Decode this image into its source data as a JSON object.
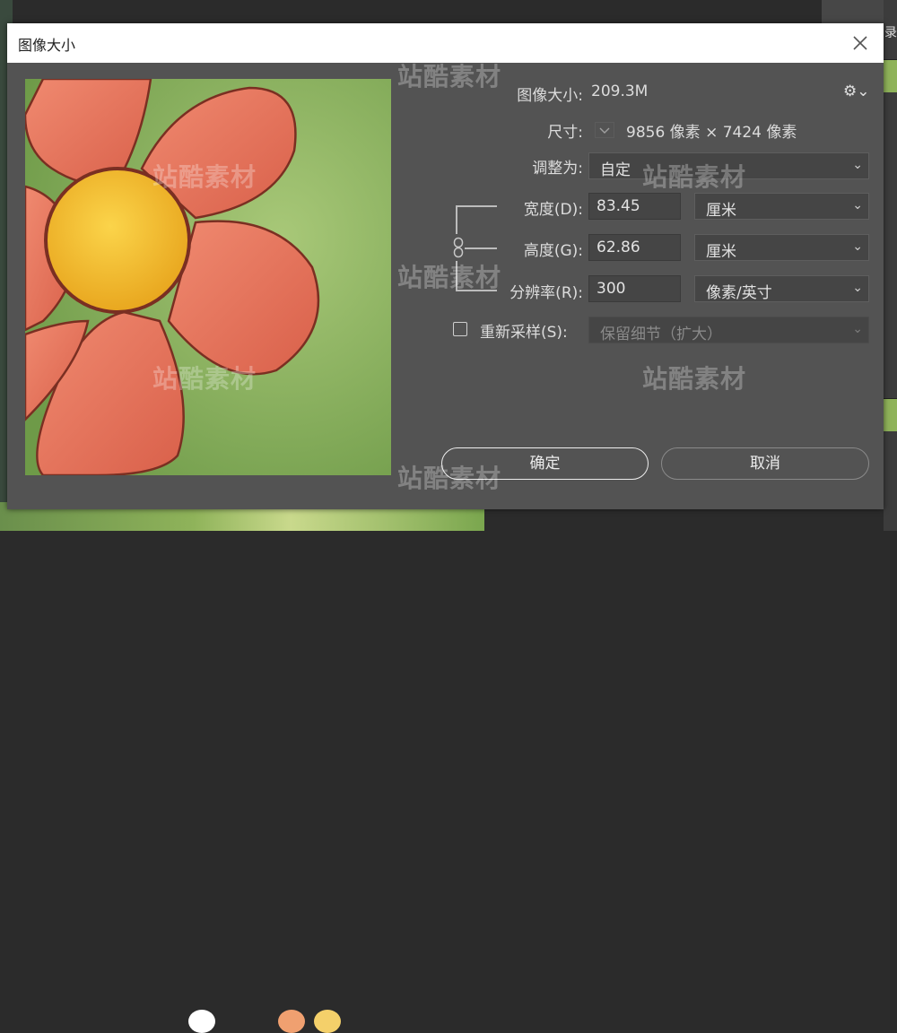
{
  "window": {
    "title": "图像大小"
  },
  "background": {
    "right_edge_text": "录"
  },
  "image_size": {
    "label": "图像大小:",
    "value": "209.3M"
  },
  "dimensions": {
    "label": "尺寸:",
    "value": "9856 像素  ×  7424 像素"
  },
  "fit_to": {
    "label": "调整为:",
    "value": "自定"
  },
  "width": {
    "label": "宽度(D):",
    "value": "83.45",
    "unit": "厘米"
  },
  "height": {
    "label": "高度(G):",
    "value": "62.86",
    "unit": "厘米"
  },
  "resolution": {
    "label": "分辨率(R):",
    "value": "300",
    "unit": "像素/英寸"
  },
  "resample": {
    "label": "重新采样(S):",
    "checked": false,
    "value": "保留细节（扩大）"
  },
  "buttons": {
    "ok": "确定",
    "cancel": "取消"
  },
  "watermark": {
    "text": "站酷素材"
  },
  "colors": {
    "dialog_bg": "#535353",
    "titlebar_bg": "#ffffff",
    "field_bg": "#454545",
    "petal": "#e8735a",
    "flower_center": "#f3c22e",
    "preview_bg": "#8fb35a"
  }
}
